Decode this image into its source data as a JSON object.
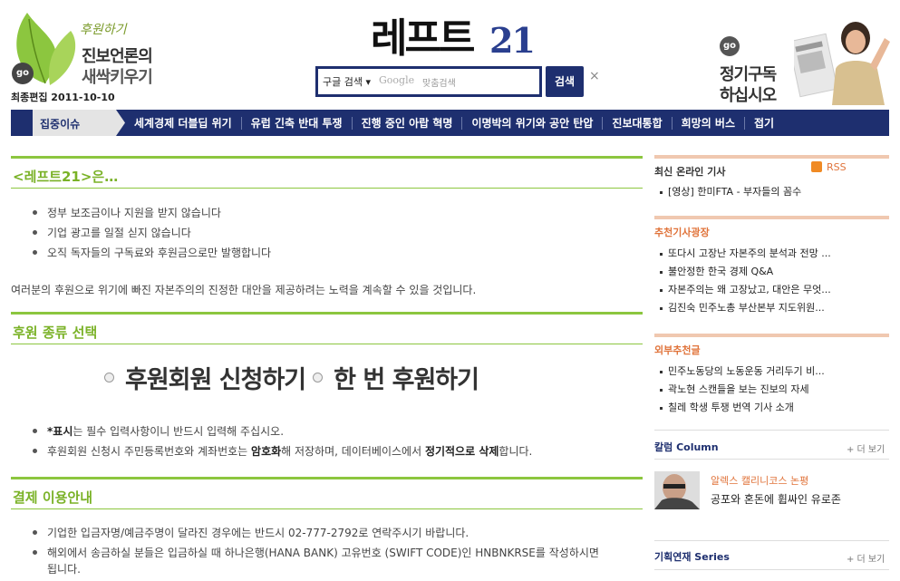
{
  "header": {
    "donate_script": "후원하기",
    "donate_line1": "진보언론의",
    "donate_line2": "새싹키우기",
    "go_label": "go",
    "last_edited": "최종편집 2011-10-10",
    "logo_text": "레프트",
    "logo_num": "21",
    "search": {
      "engine": "구글 검색 ▾",
      "google": "Google",
      "placeholder": "맞춤검색",
      "button": "검색",
      "close": "×"
    },
    "subscribe_line1": "정기구독",
    "subscribe_line2": "하십시오"
  },
  "nav": {
    "active": "집중이슈",
    "items": [
      "세계경제 더블딥 위기",
      "유럽 긴축 반대 투쟁",
      "진행 중인 아랍 혁명",
      "이명박의 위기와 공안 탄압",
      "진보대통합",
      "희망의 버스",
      "접기"
    ]
  },
  "main": {
    "section1": {
      "title": "<레프트21>은…",
      "bullets": [
        "정부 보조금이나 지원을 받지 않습니다",
        "기업 광고를 일절 싣지 않습니다",
        "오직 독자들의 구독료와 후원금으로만 발행합니다"
      ],
      "desc": "여러분의 후원으로 위기에 빠진 자본주의의 진정한 대안을 제공하려는 노력을 계속할 수 있을 것입니다."
    },
    "section2": {
      "title": "후원 종류 선택",
      "option1": "후원회원 신청하기",
      "option2": "한 번 후원하기",
      "note1_bold": "*표시",
      "note1_rest": "는 필수 입력사항이니 반드시 입력해 주십시오.",
      "note2_a": "후원회원 신청시 주민등록번호와 계좌번호는 ",
      "note2_b": "암호화",
      "note2_c": "해 저장하며, 데이터베이스에서 ",
      "note2_d": "정기적으로 삭제",
      "note2_e": "합니다."
    },
    "section3": {
      "title": "결제 이용안내",
      "bullet1": "기업한 입금자명/예금주명이 달라진 경우에는 반드시 02-777-2792로 연락주시기 바랍니다.",
      "bullet2": "해외에서 송금하실 분들은 입금하실 때 하나은행(HANA BANK) 고유번호 (SWIFT CODE)인 HNBNKRSE를 작성하시면",
      "bullet2_cont": "됩니다."
    }
  },
  "sidebar": {
    "latest": {
      "title": "최신 온라인 기사",
      "rss": "RSS",
      "items": [
        "[영상] 한미FTA - 부자들의 꼼수"
      ]
    },
    "recommended": {
      "title": "추천기사광장",
      "items": [
        "또다시 고장난 자본주의 분석과 전망 ...",
        "불안정한 한국 경제 Q&A",
        "자본주의는 왜 고장났고, 대안은 무엇...",
        "김진숙 민주노총 부산본부 지도위원..."
      ]
    },
    "external": {
      "title": "외부추천글",
      "items": [
        "민주노동당의 노동운동 거리두기 비...",
        "곽노현 스캔들을 보는 진보의 자세",
        "칠레 학생 투쟁 번역 기사 소개"
      ]
    },
    "column": {
      "title": "칼럼 Column",
      "more": "+ 더 보기",
      "author": "알렉스 캘리니코스 논평",
      "headline": "공포와 혼돈에 휩싸인 유로존"
    },
    "series": {
      "title": "기획연재 Series",
      "more": "+ 더 보기"
    }
  },
  "colors": {
    "navy": "#1e2f6f",
    "green": "#7ab227",
    "orange": "#e0733a"
  }
}
